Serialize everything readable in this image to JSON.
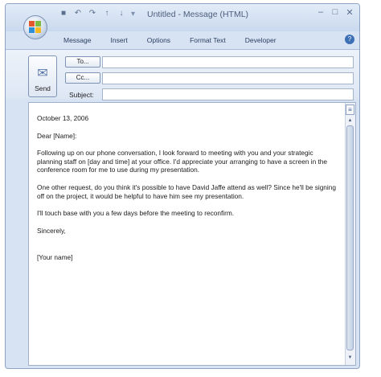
{
  "window": {
    "title": "Untitled - Message (HTML)"
  },
  "quick_access": [
    "save-icon",
    "undo-icon",
    "redo-icon",
    "up-icon",
    "down-icon"
  ],
  "ribbon": {
    "tabs": [
      "Message",
      "Insert",
      "Options",
      "Format Text",
      "Developer"
    ]
  },
  "header": {
    "send_label": "Send",
    "to_label": "To...",
    "cc_label": "Cc...",
    "subject_label": "Subject:",
    "to_value": "",
    "cc_value": "",
    "subject_value": ""
  },
  "message": {
    "date": "October 13, 2006",
    "greeting": "Dear [Name]:",
    "para1": "Following up on our phone conversation, I look forward to meeting with you and your strategic planning staff on [day and time] at your office. I'd appreciate your arranging to have a screen in the conference room for me to use during my presentation.",
    "para2": "One other request, do you think it's possible to have David Jaffe attend as well? Since he'll be signing off on the project, it would be helpful to have him see my presentation.",
    "para3": "I'll touch base with you a few days before the meeting to reconfirm.",
    "closing": "Sincerely,",
    "signature": "[Your name]"
  },
  "colors": {
    "frame": "#d7e3f2",
    "accent": "#3d6fb5"
  }
}
